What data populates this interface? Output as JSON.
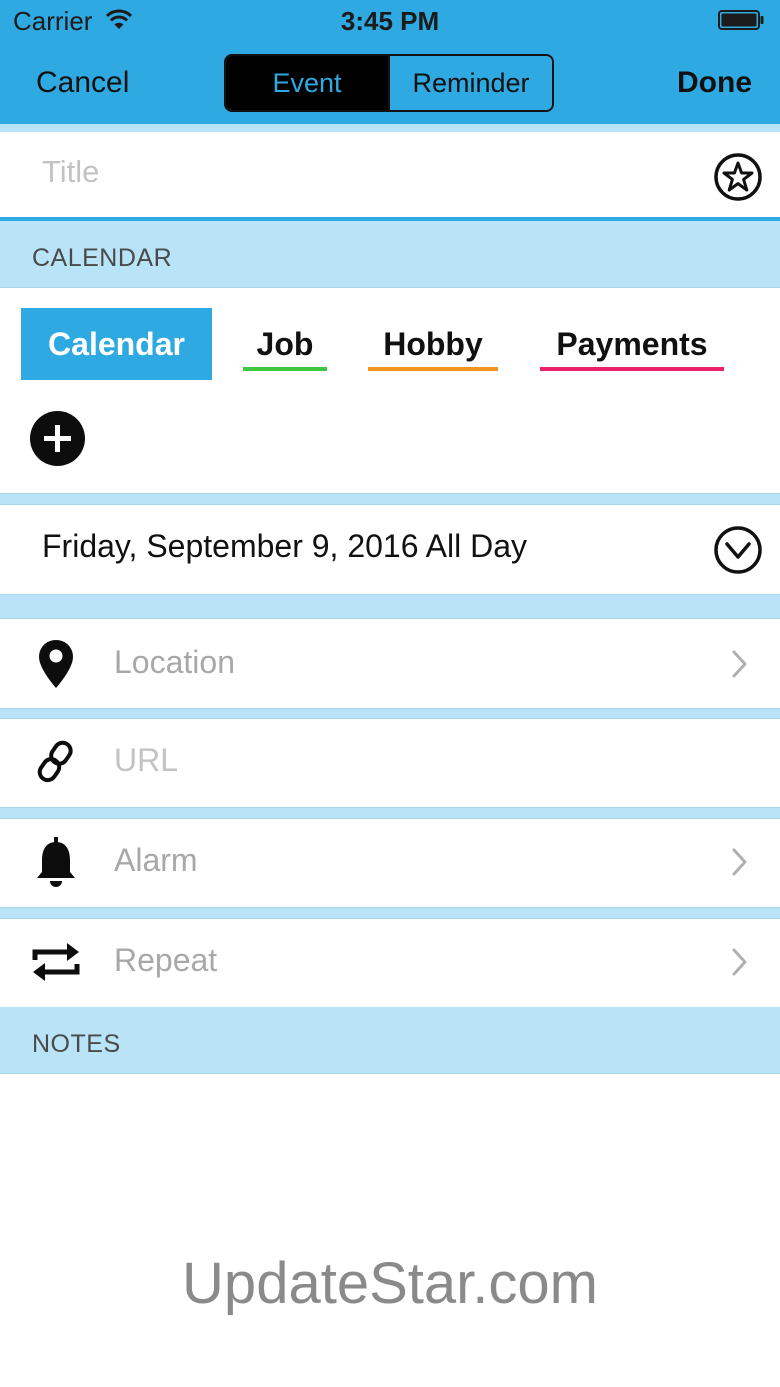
{
  "status_bar": {
    "carrier": "Carrier",
    "time": "3:45 PM"
  },
  "nav": {
    "cancel_label": "Cancel",
    "done_label": "Done",
    "segments": {
      "event": "Event",
      "reminder": "Reminder"
    },
    "selected_segment": "Event"
  },
  "title_field": {
    "placeholder": "Title",
    "value": ""
  },
  "calendar_section": {
    "header": "CALENDAR",
    "calendars": [
      {
        "label": "Calendar",
        "selected": true,
        "color": "#2fa9e1"
      },
      {
        "label": "Job",
        "selected": false,
        "color": "#3fc53f"
      },
      {
        "label": "Hobby",
        "selected": false,
        "color": "#f79420"
      },
      {
        "label": "Payments",
        "selected": false,
        "color": "#ec1f6a"
      }
    ]
  },
  "date_row": {
    "text": "Friday, September 9, 2016 All Day"
  },
  "rows": {
    "location": "Location",
    "url": "URL",
    "alarm": "Alarm",
    "repeat": "Repeat"
  },
  "notes_section": {
    "header": "NOTES"
  },
  "watermark": "UpdateStar.com",
  "colors": {
    "accent": "#2fa9e1",
    "band": "#b9e3f6"
  },
  "icons": {
    "favorite": "star-icon",
    "add_calendar": "plus-circle-icon",
    "date_expand": "chevron-down-circle-icon",
    "location": "map-pin-icon",
    "url": "link-icon",
    "alarm": "bell-icon",
    "repeat": "repeat-icon",
    "disclosure": "chevron-right-icon"
  }
}
